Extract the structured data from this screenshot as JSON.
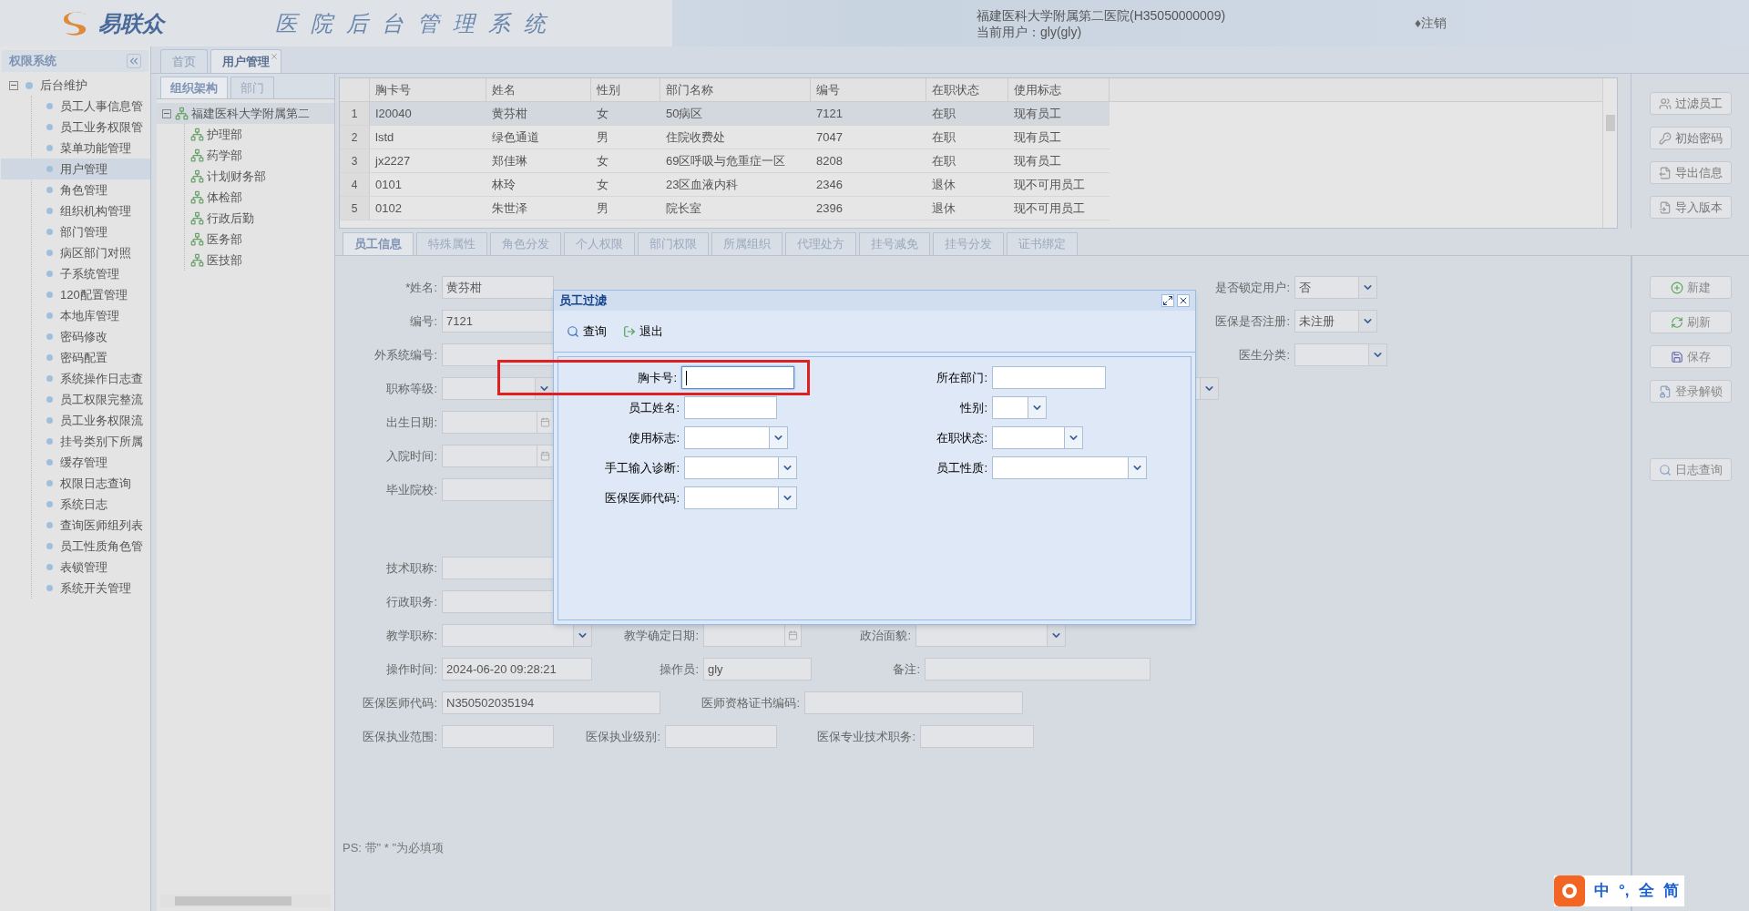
{
  "header": {
    "logo_text": "易联众",
    "system_title": "医院后台管理系统",
    "hospital": "福建医科大学附属第二医院(H35050000009)",
    "current_user": "当前用户：gly(gly)",
    "logout": "♦注销"
  },
  "sidebar": {
    "title": "权限系统",
    "tree": {
      "label": "后台维护",
      "expanded": true,
      "children": [
        {
          "label": "员工人事信息管",
          "selected": false
        },
        {
          "label": "员工业务权限管",
          "selected": false
        },
        {
          "label": "菜单功能管理",
          "selected": false
        },
        {
          "label": "用户管理",
          "selected": true
        },
        {
          "label": "角色管理",
          "selected": false
        },
        {
          "label": "组织机构管理",
          "selected": false
        },
        {
          "label": "部门管理",
          "selected": false
        },
        {
          "label": "病区部门对照",
          "selected": false
        },
        {
          "label": "子系统管理",
          "selected": false
        },
        {
          "label": "120配置管理",
          "selected": false
        },
        {
          "label": "本地库管理",
          "selected": false
        },
        {
          "label": "密码修改",
          "selected": false
        },
        {
          "label": "密码配置",
          "selected": false
        },
        {
          "label": "系统操作日志查",
          "selected": false
        },
        {
          "label": "员工权限完整流",
          "selected": false
        },
        {
          "label": "员工业务权限流",
          "selected": false
        },
        {
          "label": "挂号类别下所属",
          "selected": false
        },
        {
          "label": "缓存管理",
          "selected": false
        },
        {
          "label": "权限日志查询",
          "selected": false
        },
        {
          "label": "系统日志",
          "selected": false
        },
        {
          "label": "查询医师组列表",
          "selected": false
        },
        {
          "label": "员工性质角色管",
          "selected": false
        },
        {
          "label": "表锁管理",
          "selected": false
        },
        {
          "label": "系统开关管理",
          "selected": false
        }
      ]
    }
  },
  "main_tabs": [
    {
      "label": "首页",
      "selected": false,
      "closable": false
    },
    {
      "label": "用户管理",
      "selected": true,
      "closable": true
    }
  ],
  "org_tabs": [
    {
      "label": "组织架构",
      "selected": true
    },
    {
      "label": "部门",
      "selected": false
    }
  ],
  "org_tree": {
    "label": "福建医科大学附属第二",
    "expanded": true,
    "children": [
      {
        "label": "护理部"
      },
      {
        "label": "药学部"
      },
      {
        "label": "计划财务部"
      },
      {
        "label": "体检部"
      },
      {
        "label": "行政后勤"
      },
      {
        "label": "医务部"
      },
      {
        "label": "医技部"
      }
    ]
  },
  "table": {
    "columns": [
      "胸卡号",
      "姓名",
      "性别",
      "部门名称",
      "编号",
      "在职状态",
      "使用标志"
    ],
    "rows": [
      {
        "index": "1",
        "cells": [
          "I20040",
          "黄芬柑",
          "女",
          "50病区",
          "7121",
          "在职",
          "现有员工"
        ],
        "selected": true
      },
      {
        "index": "2",
        "cells": [
          "lstd",
          "绿色通道",
          "男",
          "住院收费处",
          "7047",
          "在职",
          "现有员工"
        ],
        "selected": false
      },
      {
        "index": "3",
        "cells": [
          "jx2227",
          "郑佳琳",
          "女",
          "69区呼吸与危重症一区",
          "8208",
          "在职",
          "现有员工"
        ],
        "selected": false
      },
      {
        "index": "4",
        "cells": [
          "0101",
          "林玲",
          "女",
          "23区血液内科",
          "2346",
          "退休",
          "现不可用员工"
        ],
        "selected": false
      },
      {
        "index": "5",
        "cells": [
          "0102",
          "朱世泽",
          "男",
          "院长室",
          "2396",
          "退休",
          "现不可用员工"
        ],
        "selected": false
      }
    ]
  },
  "toolbar_buttons": [
    "过滤员工",
    "初始密码",
    "导出信息",
    "导入版本"
  ],
  "detail_tabs": [
    {
      "label": "员工信息",
      "selected": true
    },
    {
      "label": "特殊属性",
      "selected": false
    },
    {
      "label": "角色分发",
      "selected": false
    },
    {
      "label": "个人权限",
      "selected": false
    },
    {
      "label": "部门权限",
      "selected": false
    },
    {
      "label": "所属组织",
      "selected": false
    },
    {
      "label": "代理处方",
      "selected": false
    },
    {
      "label": "挂号减免",
      "selected": false
    },
    {
      "label": "挂号分发",
      "selected": false
    },
    {
      "label": "证书绑定",
      "selected": false
    }
  ],
  "form_rows": [
    [
      {
        "label": "*姓名:",
        "kind": "text",
        "value": "黄芬柑"
      },
      {
        "label": "是否锁定用户:",
        "kind": "select",
        "value": "否"
      }
    ],
    [
      {
        "label": "编号:",
        "kind": "text",
        "value": "7121"
      },
      {
        "label": "医保是否注册:",
        "kind": "select",
        "value": "未注册"
      }
    ],
    [
      {
        "label": "外系统编号:",
        "kind": "text"
      },
      {
        "label": "医生分类:",
        "kind": "select"
      }
    ],
    [
      {
        "label": "职称等级:",
        "kind": "select"
      },
      {
        "kind": "select"
      }
    ],
    [
      {
        "label": "出生日期:",
        "kind": "date"
      }
    ],
    [
      {
        "label": "入院时间:",
        "kind": "date"
      }
    ],
    [
      {
        "label": "毕业院校:",
        "kind": "text"
      }
    ],
    [
      {
        "label": "技术职称:",
        "kind": "text"
      }
    ],
    [
      {
        "label": "行政职务:",
        "kind": "text"
      }
    ],
    [
      {
        "label": "教学职称:",
        "kind": "select"
      },
      {
        "label": "教学确定日期:",
        "kind": "date"
      },
      {
        "label": "政治面貌:",
        "kind": "select"
      }
    ],
    [
      {
        "label": "操作时间:",
        "kind": "text",
        "value": "2024-06-20 09:28:21"
      },
      {
        "label": "操作员:",
        "kind": "text",
        "value": "gly"
      },
      {
        "label": "备注:",
        "kind": "text"
      }
    ],
    [
      {
        "label": "医保医师代码:",
        "kind": "text",
        "value": "N350502035194"
      },
      {
        "label": "医师资格证书编码:",
        "kind": "text"
      }
    ],
    [
      {
        "label": "医保执业范围:",
        "kind": "text"
      },
      {
        "label": "医保执业级别:",
        "kind": "text"
      },
      {
        "label": "医保专业技术职务:",
        "kind": "text"
      }
    ]
  ],
  "action_buttons": [
    "新建",
    "刷新",
    "保存",
    "登录解锁",
    "日志查询"
  ],
  "note": "PS: 带\" * \"为必填项",
  "dialog": {
    "title": "员工过滤",
    "toolbar": [
      "查询",
      "退出"
    ],
    "fields": [
      {
        "label": "胸卡号:",
        "kind": "text",
        "highlighted": true,
        "focused": true
      },
      {
        "label": "所在部门:",
        "kind": "text",
        "highlighted": false,
        "focused": false
      },
      {
        "label": "员工姓名:",
        "kind": "text",
        "highlighted": false,
        "focused": false
      },
      {
        "label": "性别:",
        "kind": "select",
        "highlighted": false,
        "focused": false
      },
      {
        "label": "使用标志:",
        "kind": "select",
        "highlighted": false,
        "focused": false
      },
      {
        "label": "在职状态:",
        "kind": "select",
        "highlighted": false,
        "focused": false
      },
      {
        "label": "手工输入诊断:",
        "kind": "select",
        "highlighted": false,
        "focused": false
      },
      {
        "label": "员工性质:",
        "kind": "select",
        "highlighted": false,
        "focused": false
      },
      {
        "label": "医保医师代码:",
        "kind": "select",
        "highlighted": false,
        "focused": false
      }
    ]
  },
  "ime_bar": [
    "中",
    "°,",
    "全",
    "简"
  ]
}
